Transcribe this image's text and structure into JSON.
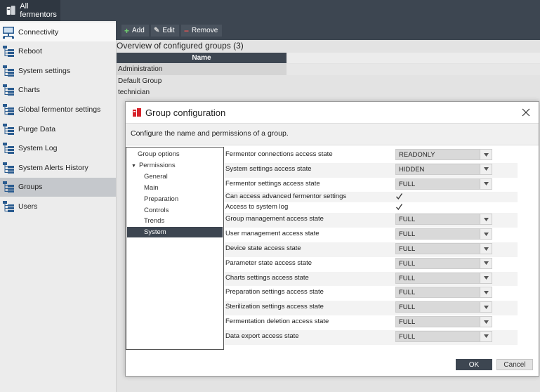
{
  "header": {
    "tab_label": "All fermentors",
    "logo_icon": "fermentor-logo-icon"
  },
  "sidebar": {
    "items": [
      {
        "label": "Connectivity",
        "icon": "network-icon"
      },
      {
        "label": "Reboot",
        "icon": "tree-icon"
      },
      {
        "label": "System settings",
        "icon": "tree-icon"
      },
      {
        "label": "Charts",
        "icon": "tree-icon"
      },
      {
        "label": "Global fermentor settings",
        "icon": "tree-icon"
      },
      {
        "label": "Purge Data",
        "icon": "tree-icon"
      },
      {
        "label": "System Log",
        "icon": "tree-icon"
      },
      {
        "label": "System Alerts History",
        "icon": "tree-icon"
      },
      {
        "label": "Groups",
        "icon": "tree-icon"
      },
      {
        "label": "Users",
        "icon": "tree-icon"
      }
    ],
    "selected": "Groups"
  },
  "toolbar": {
    "add_label": "Add",
    "edit_label": "Edit",
    "remove_label": "Remove"
  },
  "overview": {
    "title": "Overview of configured groups (3)",
    "column_header": "Name",
    "rows": [
      "Administration",
      "Default Group",
      "technician"
    ],
    "selected_row": "Administration"
  },
  "dialog": {
    "title": "Group configuration",
    "subtitle": "Configure the name and permissions of a group.",
    "tree": {
      "items": [
        {
          "label": "Group options"
        },
        {
          "label": "Permissions",
          "expander": "▼"
        },
        {
          "label": "General"
        },
        {
          "label": "Main"
        },
        {
          "label": "Preparation"
        },
        {
          "label": "Controls"
        },
        {
          "label": "Trends"
        },
        {
          "label": "System"
        }
      ],
      "selected": "System"
    },
    "permissions": [
      {
        "label": "Fermentor connections access state",
        "type": "select",
        "value": "READONLY"
      },
      {
        "label": "System settings access state",
        "type": "select",
        "value": "HIDDEN"
      },
      {
        "label": "Fermentor settings access state",
        "type": "select",
        "value": "FULL"
      },
      {
        "label": "Can access advanced fermentor settings",
        "type": "checkbox",
        "checked": true
      },
      {
        "label": "Access to system log",
        "type": "checkbox",
        "checked": true
      },
      {
        "label": "Group management access state",
        "type": "select",
        "value": "FULL"
      },
      {
        "label": "User management access state",
        "type": "select",
        "value": "FULL"
      },
      {
        "label": "Device state access state",
        "type": "select",
        "value": "FULL"
      },
      {
        "label": "Parameter state access state",
        "type": "select",
        "value": "FULL"
      },
      {
        "label": "Charts settings access state",
        "type": "select",
        "value": "FULL"
      },
      {
        "label": "Preparation settings access state",
        "type": "select",
        "value": "FULL"
      },
      {
        "label": "Sterilization settings access state",
        "type": "select",
        "value": "FULL"
      },
      {
        "label": "Fermentation deletion access state",
        "type": "select",
        "value": "FULL"
      },
      {
        "label": "Data export access state",
        "type": "select",
        "value": "FULL"
      }
    ],
    "ok_label": "OK",
    "cancel_label": "Cancel"
  },
  "colors": {
    "dark_bar": "#3d4651",
    "accent_red": "#d7222a",
    "selection": "#c5c8cc"
  }
}
